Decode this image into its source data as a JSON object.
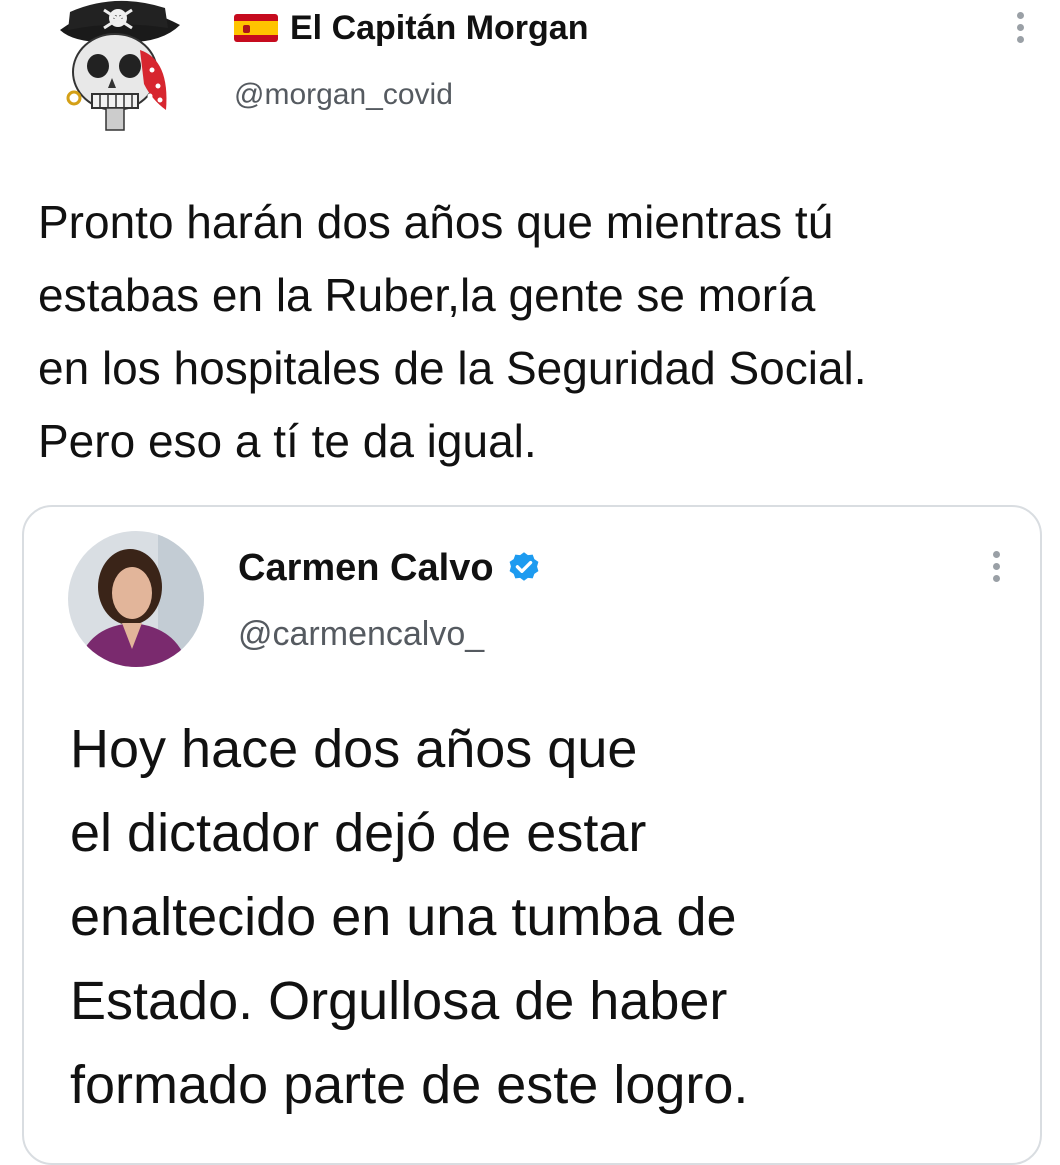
{
  "tweet": {
    "display_name": "El Capitán Morgan",
    "handle": "@morgan_covid",
    "flag_icon": "spain-flag-icon",
    "avatar_icon": "pirate-skull-avatar",
    "text": "Pronto harán dos años que mientras tú\nestabas en la Ruber,la gente se moría\nen los hospitales de la Seguridad Social.\nPero eso a tí te da igual."
  },
  "quoted_tweet": {
    "display_name": "Carmen Calvo",
    "handle": "@carmencalvo_",
    "verified_icon": "verified-badge-icon",
    "avatar_icon": "profile-photo-avatar",
    "text": "Hoy hace dos años que\nel dictador dejó de estar\nenaltecido en una tumba de\nEstado. Orgullosa de haber\nformado parte de este logro."
  },
  "colors": {
    "verified_blue": "#1d9bf0",
    "handle_gray": "#555a60",
    "border_gray": "#d9dde1",
    "text": "#111111"
  }
}
